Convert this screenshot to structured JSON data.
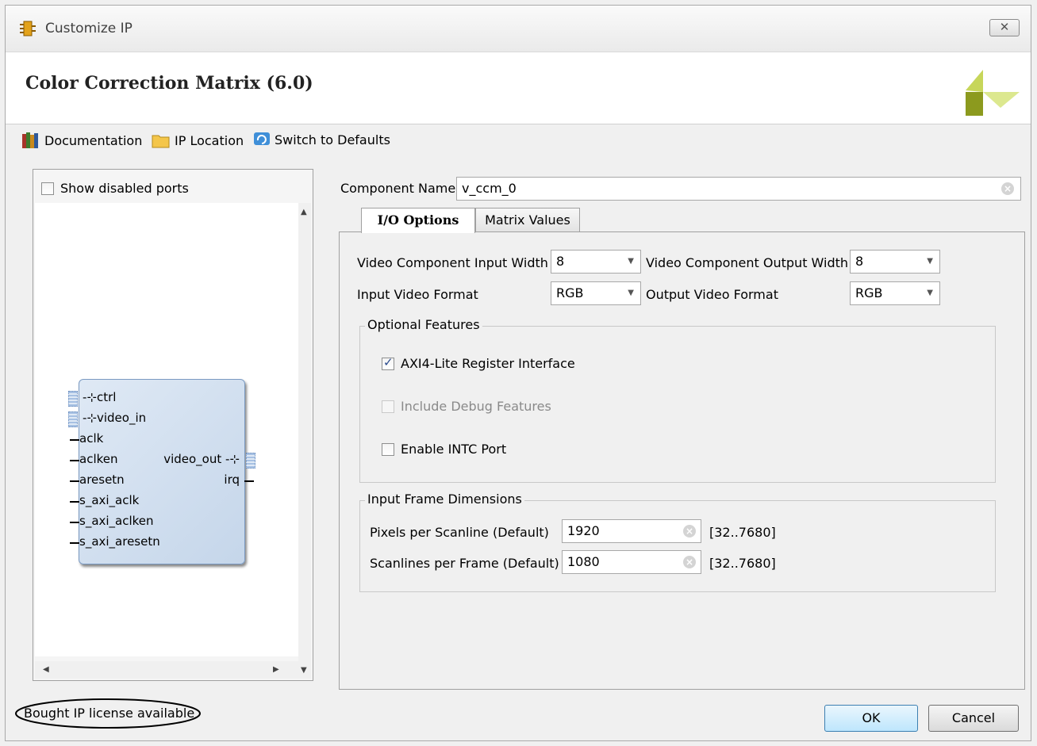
{
  "window": {
    "title": "Customize IP",
    "close_label": "☒"
  },
  "header": {
    "title": "Color Correction Matrix (6.0)"
  },
  "toolbar": {
    "documentation": "Documentation",
    "ip_location": "IP Location",
    "switch_defaults": "Switch to Defaults"
  },
  "left_panel": {
    "show_disabled_ports": "Show disabled ports",
    "block": {
      "ports_left": [
        "ctrl",
        "video_in",
        "aclk",
        "aclken",
        "aresetn",
        "s_axi_aclk",
        "s_axi_aclken",
        "s_axi_aresetn"
      ],
      "ports_right": [
        "video_out",
        "irq"
      ]
    }
  },
  "component": {
    "label": "Component Name",
    "value": "v_ccm_0"
  },
  "tabs": [
    {
      "label": "I/O Options",
      "active": true
    },
    {
      "label": "Matrix Values",
      "active": false
    }
  ],
  "io_options": {
    "input_width_label": "Video Component Input Width",
    "input_width_value": "8",
    "output_width_label": "Video Component Output Width",
    "output_width_value": "8",
    "input_format_label": "Input Video Format",
    "input_format_value": "RGB",
    "output_format_label": "Output Video Format",
    "output_format_value": "RGB"
  },
  "optional_features": {
    "title": "Optional Features",
    "axi4_lite": {
      "label": "AXI4-Lite Register Interface",
      "checked": true
    },
    "debug": {
      "label": "Include Debug Features",
      "checked": false,
      "disabled": true
    },
    "intc": {
      "label": "Enable INTC Port",
      "checked": false
    }
  },
  "frame_dims": {
    "title": "Input Frame Dimensions",
    "pixels_label": "Pixels per Scanline (Default)",
    "pixels_value": "1920",
    "pixels_range": "[32..7680]",
    "scanlines_label": "Scanlines per Frame (Default)",
    "scanlines_value": "1080",
    "scanlines_range": "[32..7680]"
  },
  "footer": {
    "license": "Bought IP license available",
    "ok": "OK",
    "cancel": "Cancel"
  },
  "colors": {
    "accent_blue": "#2a4b8d",
    "ok_button": "#bee6fd",
    "logo_olive": "#8c9a1e",
    "logo_light": "#d6e38a"
  }
}
